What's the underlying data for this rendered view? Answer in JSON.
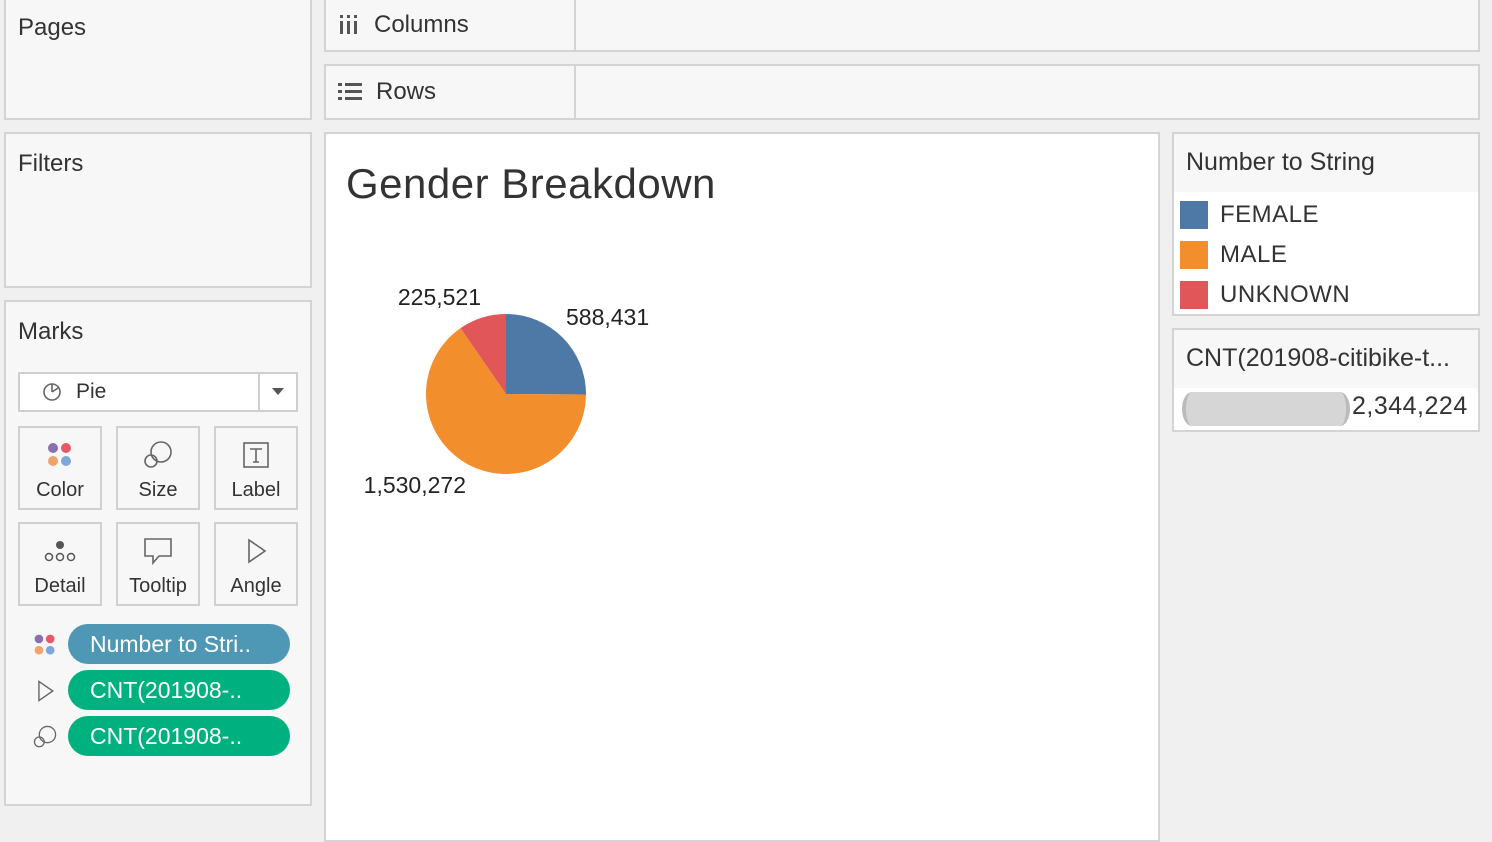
{
  "pages": {
    "title": "Pages"
  },
  "filters": {
    "title": "Filters"
  },
  "shelves": {
    "columns_label": "Columns",
    "rows_label": "Rows"
  },
  "marks": {
    "title": "Marks",
    "mark_type": "Pie",
    "buttons": {
      "color": "Color",
      "size": "Size",
      "label": "Label",
      "detail": "Detail",
      "tooltip": "Tooltip",
      "angle": "Angle"
    },
    "pills": [
      {
        "text": "Number to Stri..",
        "role": "color",
        "icon": "color-dots-icon",
        "color": "#4e97b5"
      },
      {
        "text": "CNT(201908-..",
        "role": "angle",
        "icon": "angle-icon",
        "color": "#00b180"
      },
      {
        "text": "CNT(201908-..",
        "role": "size",
        "icon": "size-icon",
        "color": "#00b180"
      }
    ]
  },
  "viz": {
    "title": "Gender Breakdown"
  },
  "chart_data": {
    "type": "pie",
    "title": "Gender Breakdown",
    "slices": [
      {
        "category": "FEMALE",
        "value": 588431,
        "label": "588,431",
        "color": "#4e79a7"
      },
      {
        "category": "MALE",
        "value": 1530272,
        "label": "1,530,272",
        "color": "#f28e2b"
      },
      {
        "category": "UNKNOWN",
        "value": 225521,
        "label": "225,521",
        "color": "#e15759"
      }
    ],
    "total": 2344224
  },
  "color_legend": {
    "title": "Number to String",
    "items": [
      {
        "label": "FEMALE",
        "color": "#4e79a7"
      },
      {
        "label": "MALE",
        "color": "#f28e2b"
      },
      {
        "label": "UNKNOWN",
        "color": "#e15759"
      }
    ]
  },
  "size_legend": {
    "title": "CNT(201908-citibike-t...",
    "value": "2,344,224"
  }
}
